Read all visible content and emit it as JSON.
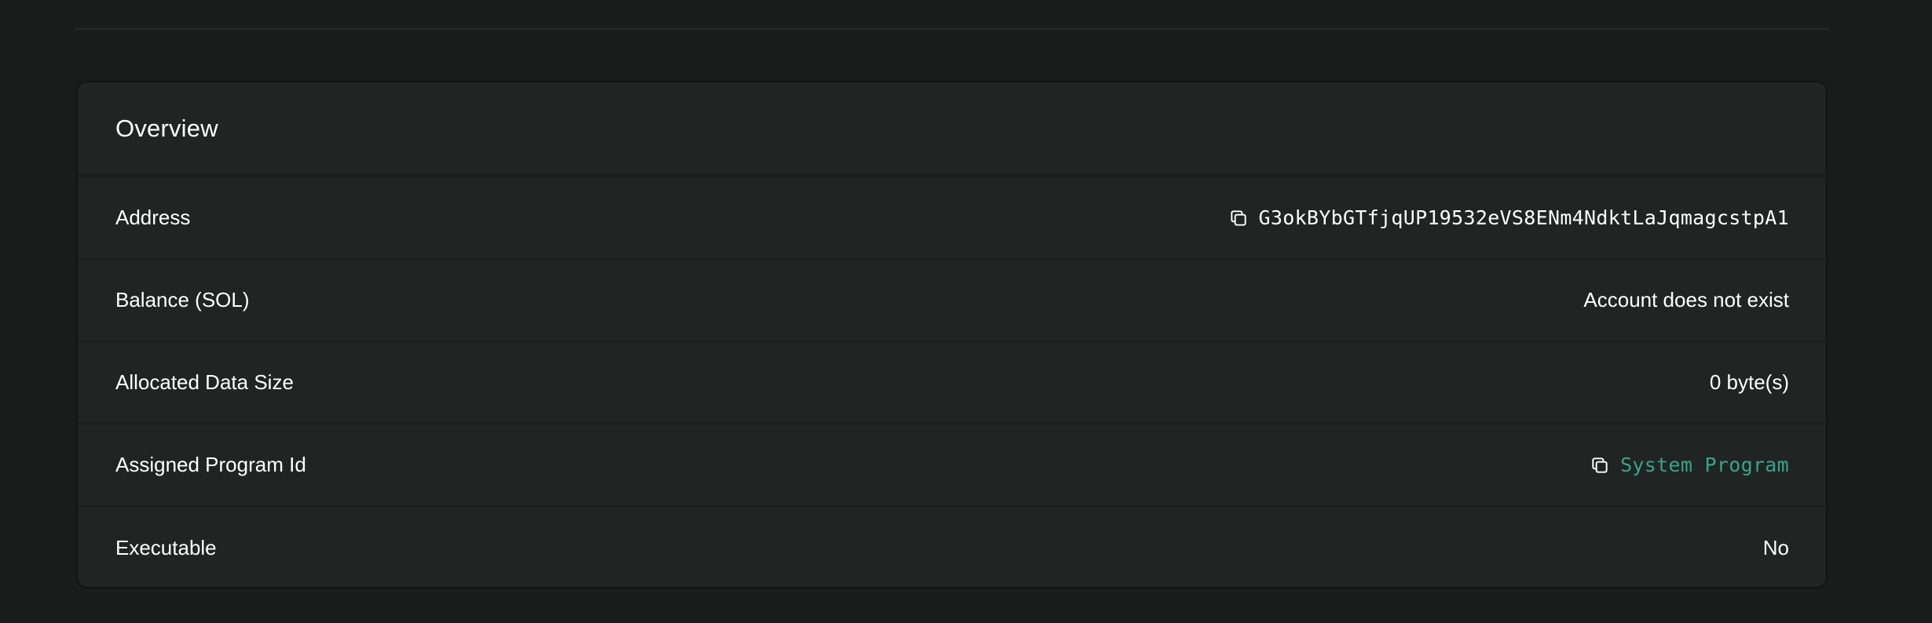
{
  "overview": {
    "title": "Overview",
    "rows": [
      {
        "label": "Address",
        "value": "G3okBYbGTfjqUP19532eVS8ENm4NdktLaJqmagcstpA1",
        "icon": "copy-icon"
      },
      {
        "label": "Balance (SOL)",
        "value": "Account does not exist"
      },
      {
        "label": "Allocated Data Size",
        "value": "0 byte(s)"
      },
      {
        "label": "Assigned Program Id",
        "value": "System Program",
        "icon": "copy-icon"
      },
      {
        "label": "Executable",
        "value": "No"
      }
    ]
  },
  "colors": {
    "background": "#181c1b",
    "card": "#202423",
    "link": "#37a58b",
    "text": "#ffffff"
  }
}
